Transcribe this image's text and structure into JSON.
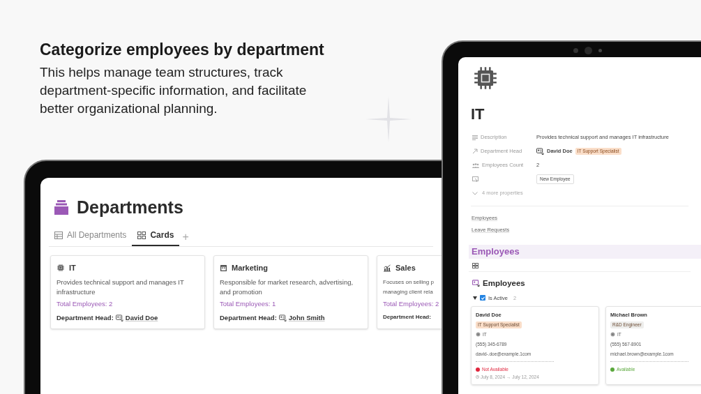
{
  "headline": "Categorize employees by department",
  "subtext": "This helps manage team structures, track department-specific information, and facilitate better organizational planning.",
  "departments_page": {
    "title": "Departments",
    "tabs": [
      {
        "label": "All Departments",
        "selected": false
      },
      {
        "label": "Cards",
        "selected": true
      }
    ],
    "add_tab": "+",
    "cards": [
      {
        "name": "IT",
        "description": "Provides technical support and manages IT infrastructure",
        "total": "Total Employees: 2",
        "head_label": "Department Head:",
        "head": "David Doe"
      },
      {
        "name": "Marketing",
        "description": "Responsible for market research, advertising, and promotion",
        "total": "Total Employees: 1",
        "head_label": "Department Head:",
        "head": "John Smith"
      },
      {
        "name": "Sales",
        "description": "Focuses on selling p\nmanaging client rela",
        "total": "Total Employees: 2",
        "head_label": "Department Head:"
      }
    ]
  },
  "department_detail": {
    "title": "IT",
    "properties": [
      {
        "kind": "text",
        "label": "Description",
        "value": "Provides technical support and manages IT infrastructure"
      },
      {
        "kind": "relation",
        "label": "Department Head",
        "value": "David Doe",
        "tag": "IT Support Specialist",
        "color": "#fadec9"
      },
      {
        "kind": "number",
        "label": "Employees Count",
        "value": "2"
      },
      {
        "kind": "button",
        "value": "New Employee"
      }
    ],
    "more": "4 more properties",
    "links": [
      "Employees",
      "Leave Requests"
    ],
    "section_heading": "Employees",
    "view_title": "Employees",
    "group": {
      "label": "Is Active",
      "checked": true,
      "expanded": true,
      "count": "2"
    },
    "employees": [
      {
        "name": "David Doe",
        "role": {
          "text": "IT Support Specialist",
          "color": "#fadec9"
        },
        "department": "IT",
        "phone": "(555) 345-6789",
        "email": "david-.doe@example.1com",
        "status": {
          "text": "Not Available",
          "color": "#e0263d"
        },
        "dates": "July 8, 2024 → July 12, 2024"
      },
      {
        "name": "Michael Brown",
        "role": {
          "text": "R&D Engineer",
          "color": "#eeeeec"
        },
        "department": "IT",
        "phone": "(555) 567-8901",
        "email": "michael.brown@example.1com",
        "status": {
          "text": "Available",
          "color": "#5aa83c"
        }
      }
    ]
  }
}
